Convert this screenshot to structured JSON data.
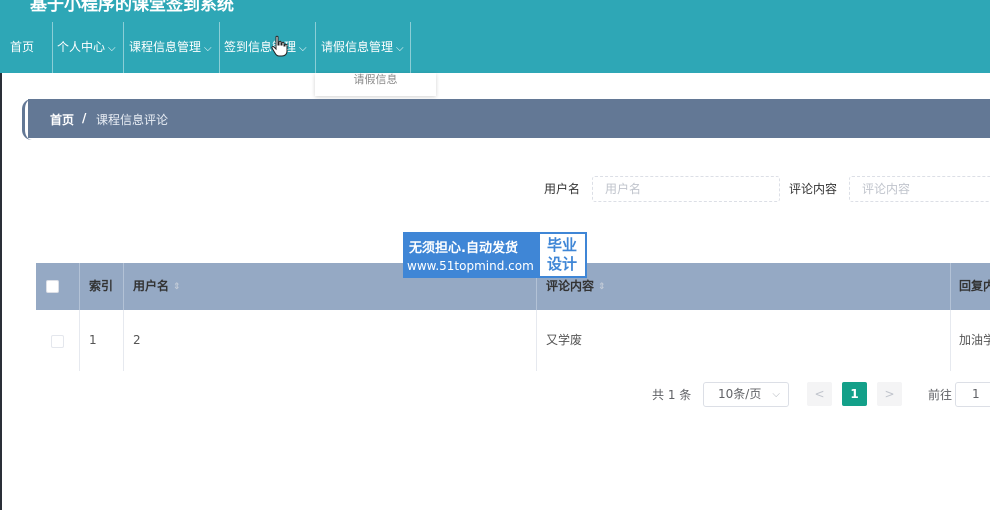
{
  "app": {
    "title": "基于小程序的课堂签到系统"
  },
  "nav": {
    "items": [
      {
        "label": "首页"
      },
      {
        "label": "个人中心"
      },
      {
        "label": "课程信息管理"
      },
      {
        "label": "签到信息管理"
      },
      {
        "label": "请假信息管理"
      }
    ],
    "dropdown_item": "请假信息"
  },
  "breadcrumb": {
    "home": "首页",
    "separator": "/",
    "current": "课程信息评论"
  },
  "search": {
    "username_label": "用户名",
    "username_placeholder": "用户名",
    "content_label": "评论内容",
    "content_placeholder": "评论内容"
  },
  "watermark": {
    "line1": "无须担心.自动发货",
    "line2": "www.51topmind.com",
    "badge": "毕业设计"
  },
  "table": {
    "headers": [
      "索引",
      "用户名",
      "评论内容",
      "回复内容"
    ],
    "rows": [
      {
        "index": "1",
        "username": "2",
        "content": "又学废",
        "reply": "加油学"
      }
    ]
  },
  "pagination": {
    "total": "共 1 条",
    "page_size": "10条/页",
    "prev": "<",
    "current": "1",
    "next": ">",
    "goto_label": "前往",
    "goto_value": "1"
  },
  "colors": {
    "nav_bg": "#2ea7b6",
    "breadcrumb_bg": "#637895",
    "table_header_bg": "#95a9c4",
    "active_page": "#13a089"
  }
}
